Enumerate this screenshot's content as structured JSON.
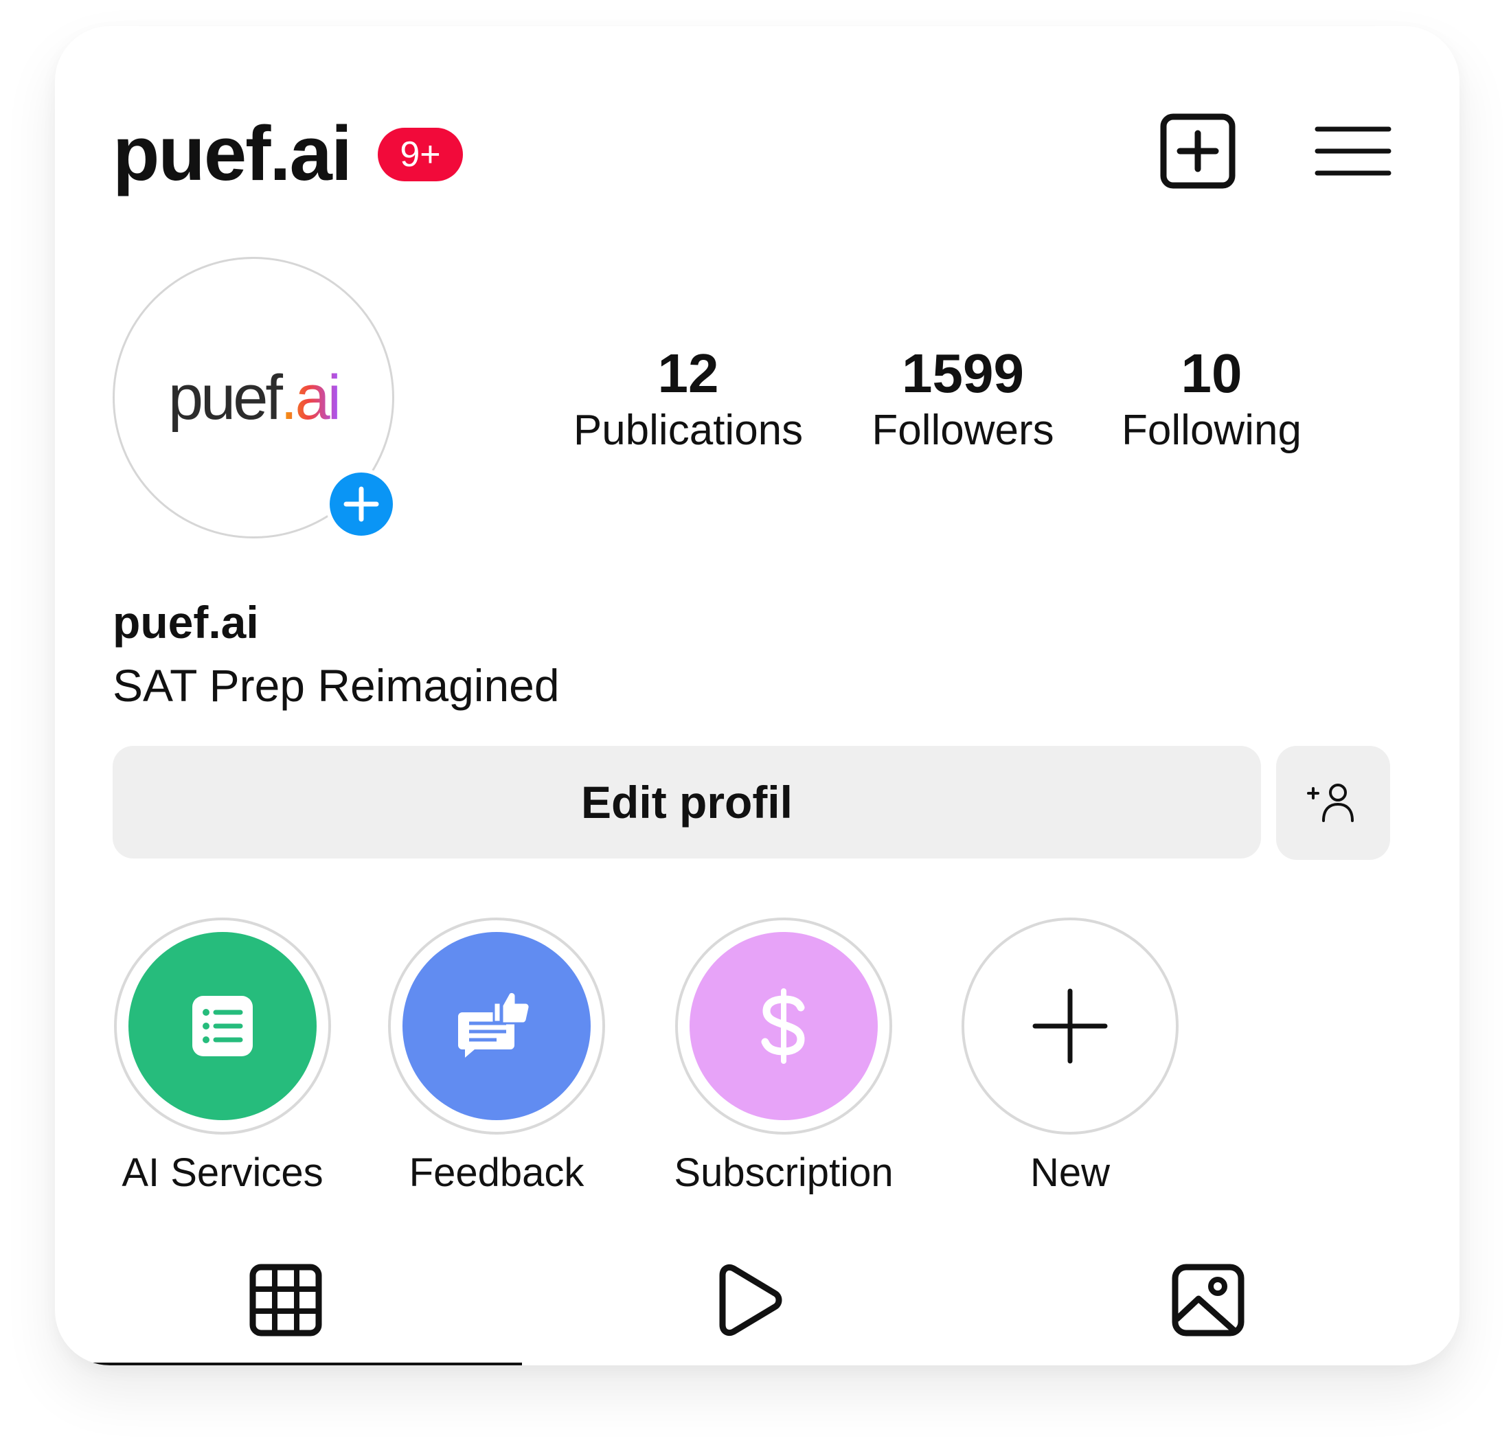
{
  "header": {
    "username": "puef.ai",
    "notification_badge": "9+",
    "new_post_icon": "plus-square-icon",
    "menu_icon": "hamburger-menu-icon"
  },
  "avatar": {
    "logo_text_main": "puef",
    "logo_text_accent": ".ai",
    "add_icon": "plus-icon"
  },
  "stats": [
    {
      "value": "12",
      "label": "Publications"
    },
    {
      "value": "1599",
      "label": "Followers"
    },
    {
      "value": "10",
      "label": "Following"
    }
  ],
  "profile": {
    "name": "puef.ai",
    "bio": "SAT Prep Reimagined"
  },
  "actions": {
    "edit_label": "Edit profil",
    "add_person_icon": "add-person-icon"
  },
  "highlights": [
    {
      "label": "AI Services",
      "icon": "list-icon",
      "color": "#26bc7c"
    },
    {
      "label": "Feedback",
      "icon": "feedback-thumbs-up-icon",
      "color": "#618cf1"
    },
    {
      "label": "Subscription",
      "icon": "dollar-icon",
      "color": "#e7a3f8"
    },
    {
      "label": "New",
      "icon": "plus-icon",
      "color": "#ffffff"
    }
  ],
  "tabs": [
    {
      "icon": "grid-icon"
    },
    {
      "icon": "reels-play-icon"
    },
    {
      "icon": "tagged-photo-icon"
    }
  ],
  "colors": {
    "badge": "#f20a3a",
    "accent_blue": "#0a95f5",
    "button_bg": "#efefef"
  }
}
